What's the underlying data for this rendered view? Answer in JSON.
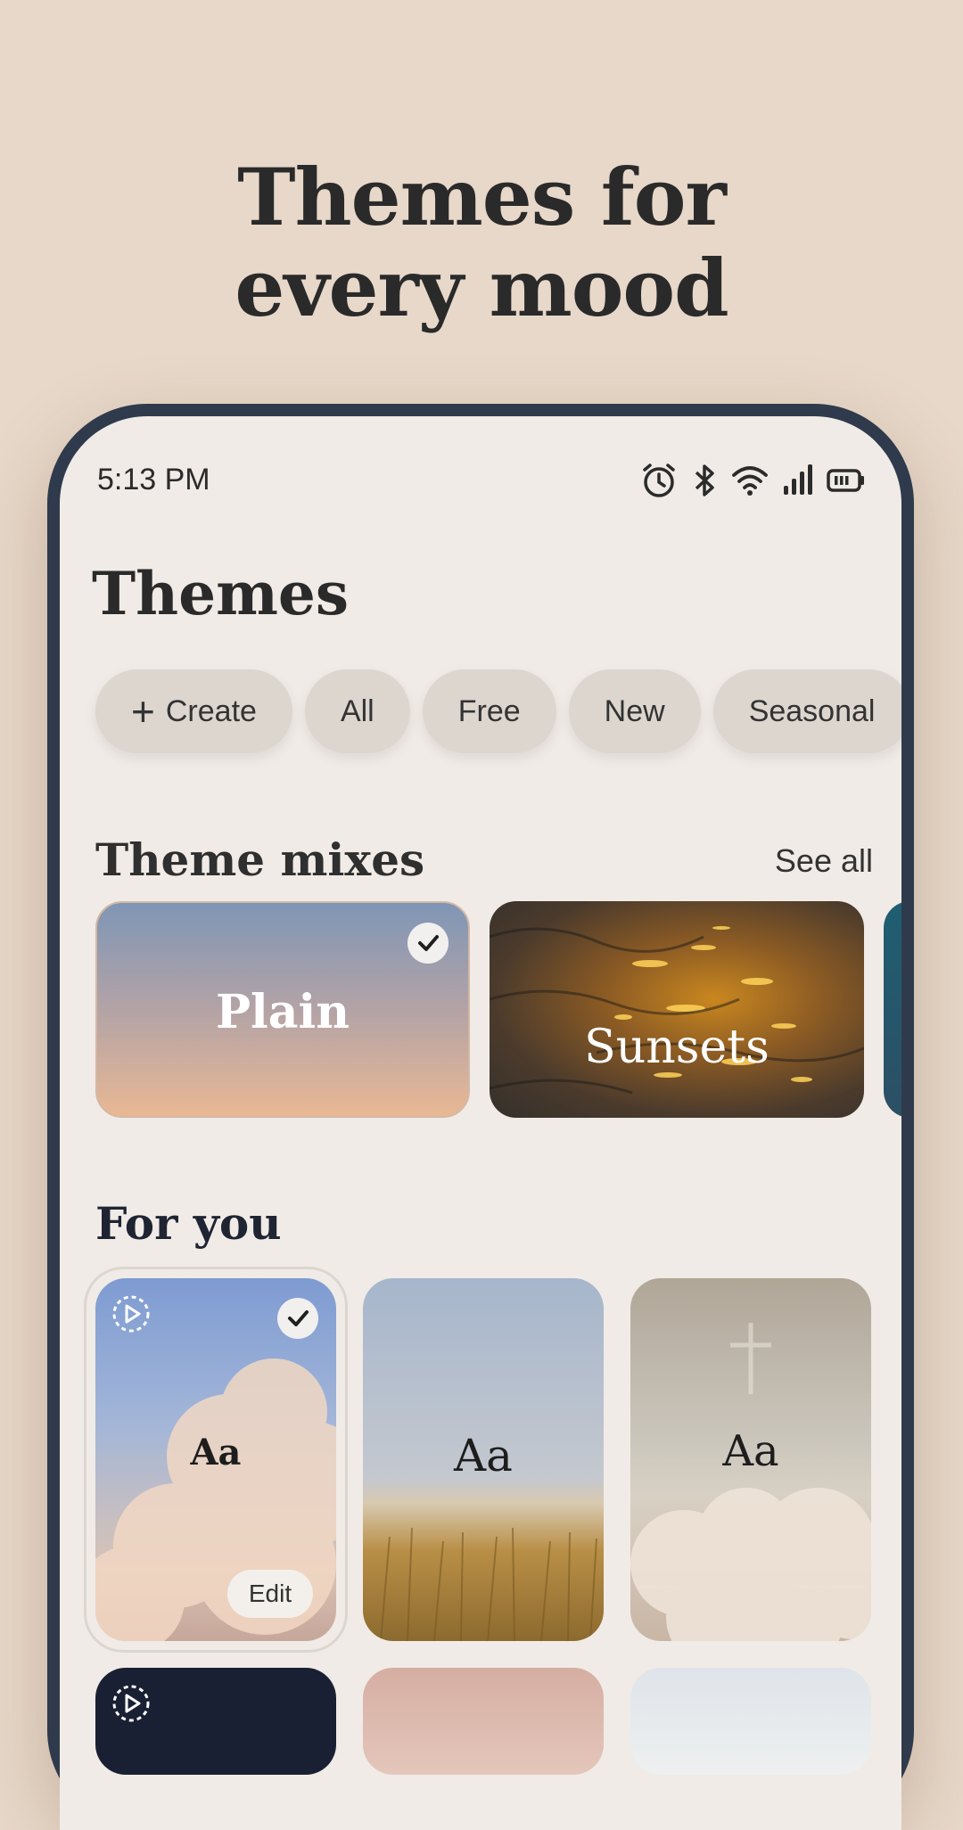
{
  "headline": {
    "line1": "Themes for",
    "line2": "every mood"
  },
  "status_bar": {
    "time": "5:13 PM",
    "icons": [
      "alarm-icon",
      "bluetooth-icon",
      "wifi-icon",
      "signal-icon",
      "battery-icon"
    ]
  },
  "page": {
    "title": "Themes"
  },
  "filters": {
    "create_label": "Create",
    "items": [
      "All",
      "Free",
      "New",
      "Seasonal"
    ]
  },
  "theme_mixes": {
    "title": "Theme mixes",
    "see_all": "See all",
    "cards": [
      {
        "label": "Plain",
        "selected": true
      },
      {
        "label": "Sunsets",
        "selected": false
      }
    ]
  },
  "for_you": {
    "title": "For you",
    "cards": [
      {
        "preview_text": "Aa",
        "selected": true,
        "edit_label": "Edit"
      },
      {
        "preview_text": "Aa",
        "selected": false
      },
      {
        "preview_text": "Aa",
        "selected": false
      }
    ]
  },
  "colors": {
    "background": "#e8d8c9",
    "phone_frame": "#2f3b4c",
    "screen": "#f0ebe6",
    "chip": "#dcd6cf"
  }
}
